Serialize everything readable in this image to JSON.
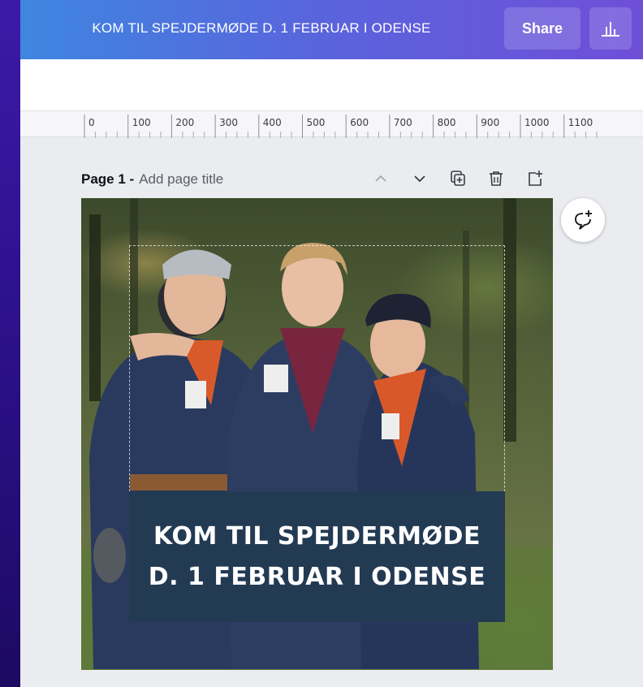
{
  "topbar": {
    "design_title": "KOM TIL SPEJDERMØDE D. 1 FEBRUAR I ODENSE",
    "share_label": "Share",
    "insights_icon": "bar-chart-icon"
  },
  "ruler": {
    "labels": [
      "0",
      "100",
      "200",
      "300",
      "400",
      "500",
      "600",
      "700",
      "800",
      "900",
      "1000",
      "1100"
    ]
  },
  "page": {
    "label": "Page 1 -",
    "title_placeholder": "Add page title",
    "tools": [
      "chevron-up-icon",
      "chevron-down-icon",
      "duplicate-page-icon",
      "delete-page-icon",
      "add-page-icon"
    ]
  },
  "design": {
    "headline_line1": "KOM TIL SPEJDERMØDE",
    "headline_line2": "D. 1 FEBRUAR I ODENSE",
    "text_box_color": "#233a53"
  },
  "comment": {
    "icon": "add-comment-icon"
  },
  "colors": {
    "topbar_start": "#3f86e0",
    "topbar_end": "#6f4fd8",
    "background": "#2b0f86",
    "workspace": "#ebecf0"
  }
}
